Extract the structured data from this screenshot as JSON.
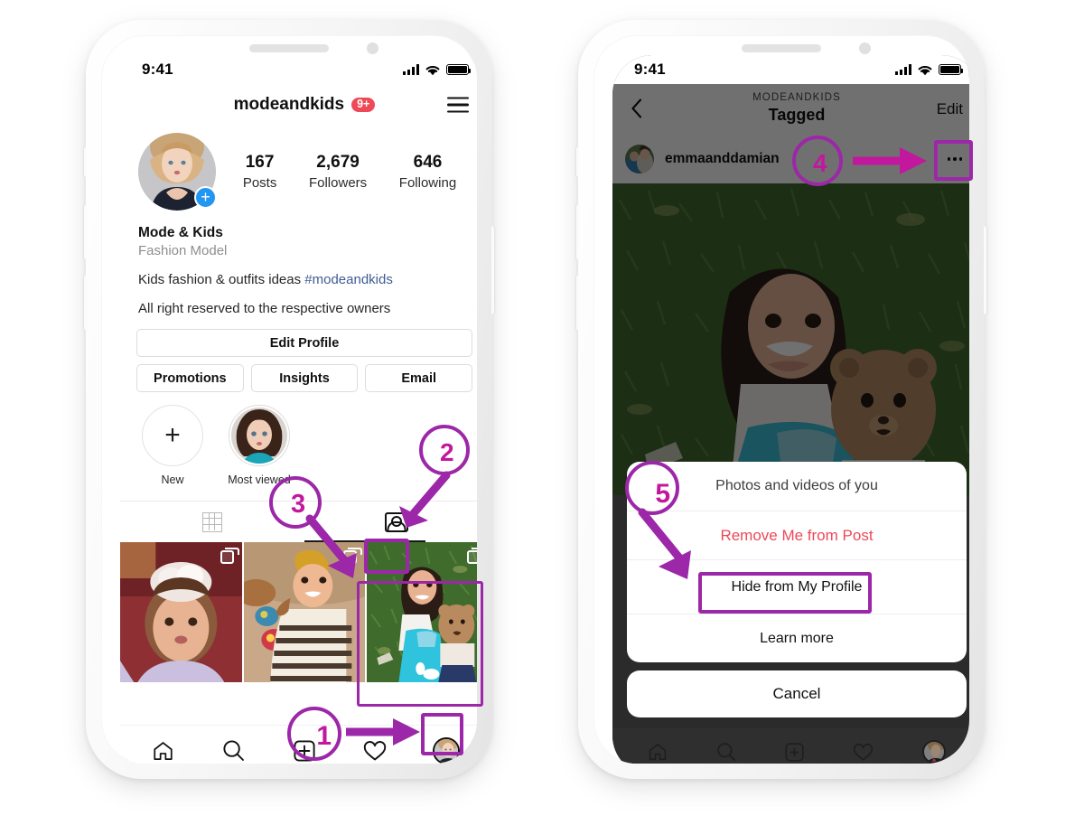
{
  "accent": "#9c27a8",
  "accent_text": "#c2189e",
  "left_phone": {
    "status": {
      "time": "9:41",
      "signal_icon": "signal-bars-icon",
      "wifi_icon": "wifi-icon",
      "battery_icon": "battery-full-icon"
    },
    "header": {
      "username": "modeandkids",
      "notification_badge": "9+",
      "menu_icon": "hamburger-menu-icon"
    },
    "avatar": {
      "add_story_label": "+"
    },
    "stats": [
      {
        "num": "167",
        "label": "Posts"
      },
      {
        "num": "2,679",
        "label": "Followers"
      },
      {
        "num": "646",
        "label": "Following"
      }
    ],
    "bio": {
      "display_name": "Mode & Kids",
      "category": "Fashion Model",
      "line1_text": "Kids fashion & outfits ideas ",
      "line1_hashtag": "#modeandkids",
      "line2": "All right reserved to the respective owners"
    },
    "buttons": {
      "edit_profile": "Edit Profile",
      "promotions": "Promotions",
      "insights": "Insights",
      "email": "Email"
    },
    "highlights": [
      {
        "caption": "New",
        "icon": "plus-icon"
      },
      {
        "caption": "Most viewed",
        "icon": "highlight-thumbnail"
      }
    ],
    "tabs": [
      {
        "name": "grid-tab",
        "icon": "grid-icon",
        "active": false
      },
      {
        "name": "tagged-tab",
        "icon": "tagged-person-icon",
        "active": true
      }
    ],
    "grid_posts": [
      {
        "alt": "baby in purple dress with lace headband",
        "multi": true
      },
      {
        "alt": "baby in striped outfit with yellow turban",
        "multi": true
      },
      {
        "alt": "girl in blue dress with teddy bear on grass",
        "multi": true,
        "highlighted": true
      }
    ],
    "bottom_nav": [
      {
        "name": "nav-home",
        "icon": "home-icon"
      },
      {
        "name": "nav-search",
        "icon": "search-icon"
      },
      {
        "name": "nav-create",
        "icon": "plus-square-icon"
      },
      {
        "name": "nav-activity",
        "icon": "heart-icon"
      },
      {
        "name": "nav-profile",
        "icon": "profile-avatar-icon",
        "highlighted": true
      }
    ]
  },
  "right_phone": {
    "status": {
      "time": "9:41",
      "signal_icon": "signal-bars-icon",
      "wifi_icon": "wifi-icon",
      "battery_icon": "battery-full-icon"
    },
    "header": {
      "back_icon": "chevron-left-icon",
      "overline": "MODEANDKIDS",
      "title": "Tagged",
      "edit_label": "Edit"
    },
    "post": {
      "username": "emmaanddamian",
      "avatar": "post-author-avatar",
      "more_icon": "ellipsis-icon",
      "photo_alt": "girl in blue dress holding teddy bear on grass"
    },
    "action_sheet": {
      "title": "Photos and videos of you",
      "options": [
        {
          "label": "Remove Me from Post",
          "style": "danger"
        },
        {
          "label": "Hide from My Profile",
          "style": "highlighted"
        },
        {
          "label": "Learn more",
          "style": "normal"
        }
      ],
      "cancel": "Cancel"
    }
  },
  "annotations": [
    {
      "id": "1",
      "target": "nav-profile / create button area"
    },
    {
      "id": "2",
      "target": "tagged-tab"
    },
    {
      "id": "3",
      "target": "tagged-post-thumbnail"
    },
    {
      "id": "4",
      "target": "post-ellipsis-button"
    },
    {
      "id": "5",
      "target": "hide-from-my-profile-option"
    }
  ]
}
